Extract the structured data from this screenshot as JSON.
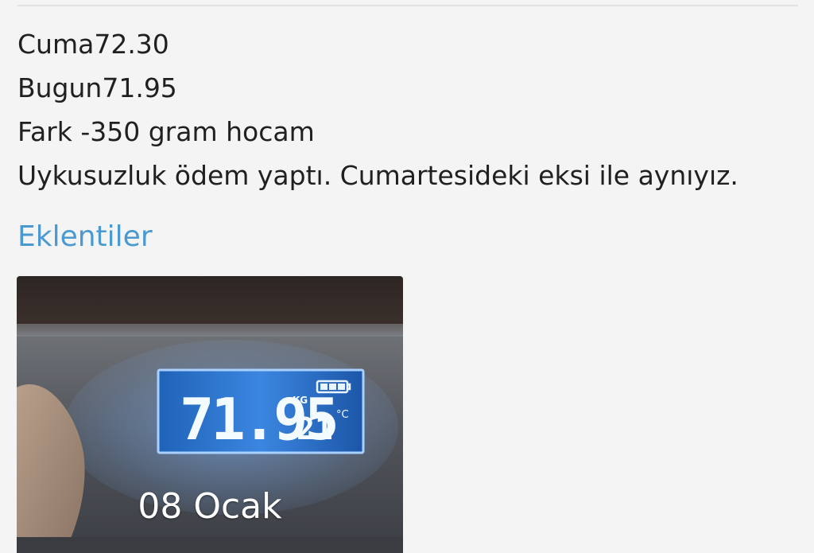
{
  "post": {
    "lines": [
      "Cuma72.30",
      "Bugun71.95",
      "Fark -350 gram hocam",
      "Uykusuzluk ödem yaptı. Cumartesideki eksi ile aynıyız."
    ]
  },
  "attachments": {
    "title": "Eklentiler",
    "items": [
      {
        "caption": "08 Ocak",
        "scale_display": {
          "weight": "71.95",
          "unit": "KG",
          "temperature": "21",
          "temperature_unit": "°C"
        }
      }
    ]
  },
  "colors": {
    "link_accent": "#4a9ad1",
    "text": "#202020",
    "background": "#f4f4f4"
  }
}
